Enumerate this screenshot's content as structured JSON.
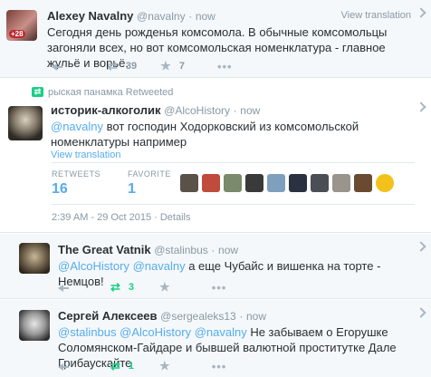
{
  "tweets": [
    {
      "name": "Alexey Navalny",
      "handle": "@navalny",
      "dot": "·",
      "time": "now",
      "view_translation": "View translation",
      "text": "Сегодня день рожденья комсомола. В обычные комсомольцы загоняли всех, но вот комсомольская номенклатура - главное жульё и ворьё.",
      "avatar_badge": "+28",
      "retweets": "39",
      "favorites": "7"
    },
    {
      "retweeted_by": "рыская панамка Retweeted",
      "name": "историк-алкоголик",
      "handle": "@AlcoHistory",
      "dot": "·",
      "time": "now",
      "mention": "@navalny",
      "text": " вот господин Ходорковский из комсомольской номенклатуры например",
      "view_translation": "View translation",
      "retweets_label": "RETWEETS",
      "retweets_value": "16",
      "favorite_label": "FAVORITE",
      "favorite_value": "1",
      "timestamp": "2:39 AM - 29 Oct 2015",
      "details": " · Details"
    },
    {
      "name": "The Great Vatnik",
      "handle": "@stalinbus",
      "dot": "·",
      "time": "now",
      "mentions": [
        "@AlcoHistory",
        "@navalny"
      ],
      "text": " а еще Чубайс и вишенка на торте - Немцов!",
      "retweets": "3"
    },
    {
      "name": "Сергей Алексеев",
      "handle": "@sergealeks13",
      "dot": "·",
      "time": "now",
      "mentions": [
        "@stalinbus",
        "@AlcoHistory",
        "@navalny"
      ],
      "text": " Не забываем о Егорушке Соломянском-Гайдаре и бывшей валютной проститутке Дале Грибаускайте",
      "retweets": "1"
    }
  ],
  "icons": {
    "reply": "reply-icon",
    "retweet": "retweet-icon",
    "favorite": "star-icon",
    "more": "more-icon",
    "chevron": "chevron-down-icon"
  },
  "colors": {
    "link": "#55acee",
    "retweet_active": "#19cf86",
    "muted": "#8899a6",
    "text": "#292f33"
  }
}
